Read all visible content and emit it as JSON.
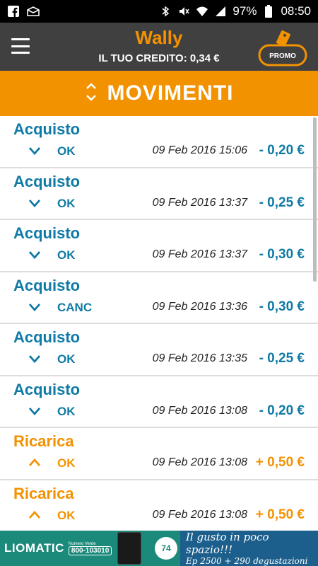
{
  "statusbar": {
    "left_icons": [
      "facebook-icon",
      "mail-icon"
    ],
    "right_icons": [
      "bluetooth-icon",
      "mute-icon",
      "wifi-icon",
      "signal-icon"
    ],
    "battery": "97%",
    "time": "08:50"
  },
  "appbar": {
    "title": "Wally",
    "credit": "IL TUO CREDITO: 0,34 €",
    "promo_label": "PROMO"
  },
  "header": {
    "title": "MOVIMENTI"
  },
  "colors": {
    "accent": "#f39200",
    "blue": "#0f7aa6",
    "appbar": "#404040"
  },
  "transactions": [
    {
      "type": "Acquisto",
      "status": "OK",
      "date": "09 Feb 2016 15:06",
      "amount": "- 0,20 €",
      "kind": "debit"
    },
    {
      "type": "Acquisto",
      "status": "OK",
      "date": "09 Feb 2016 13:37",
      "amount": "- 0,25 €",
      "kind": "debit"
    },
    {
      "type": "Acquisto",
      "status": "OK",
      "date": "09 Feb 2016 13:37",
      "amount": "- 0,30 €",
      "kind": "debit"
    },
    {
      "type": "Acquisto",
      "status": "CANC",
      "date": "09 Feb 2016 13:36",
      "amount": "- 0,30 €",
      "kind": "debit"
    },
    {
      "type": "Acquisto",
      "status": "OK",
      "date": "09 Feb 2016 13:35",
      "amount": "- 0,25 €",
      "kind": "debit"
    },
    {
      "type": "Acquisto",
      "status": "OK",
      "date": "09 Feb 2016 13:08",
      "amount": "- 0,20 €",
      "kind": "debit"
    },
    {
      "type": "Ricarica",
      "status": "OK",
      "date": "09 Feb 2016 13:08",
      "amount": "+ 0,50 €",
      "kind": "credit"
    },
    {
      "type": "Ricarica",
      "status": "OK",
      "date": "09 Feb 2016 13:08",
      "amount": "+ 0,50 €",
      "kind": "credit"
    }
  ],
  "banner": {
    "brand": "LIOMATIC",
    "numero_label": "Numero Verde",
    "phone": "800-103010",
    "badge": "74",
    "line1": "Il gusto in poco spazio!!!",
    "line2": "Ep 2500 + 290 degustazioni"
  }
}
